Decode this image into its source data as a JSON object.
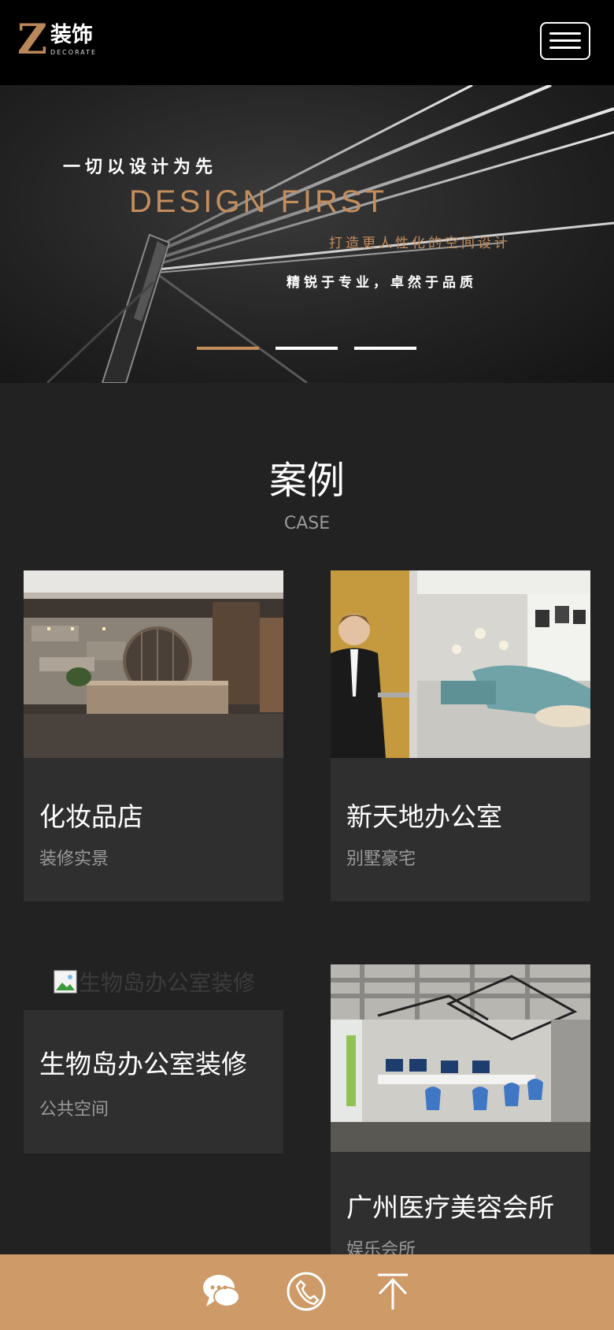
{
  "header": {
    "logo_letter": "Z",
    "logo_cn": "装饰",
    "logo_en": "DECORATE",
    "menu_icon": "hamburger-menu-icon"
  },
  "banner": {
    "line1": "一切以设计为先",
    "line2": "DESIGN FIRST",
    "line3": "打造更人性化的空间设计",
    "line4": "精锐于专业，卓然于品质",
    "slides": 3,
    "active_slide": 1
  },
  "section": {
    "title": "案例",
    "subtitle": "CASE"
  },
  "cases": [
    {
      "title": "化妆品店",
      "tag": "装修实景"
    },
    {
      "title": "新天地办公室",
      "tag": "别墅豪宅"
    },
    {
      "title": "生物岛办公室装修",
      "tag": "公共空间",
      "image_alt": "生物岛办公室装修"
    },
    {
      "title": "广州医疗美容会所",
      "tag": "娱乐会所"
    }
  ],
  "bottom_bar": {
    "icons": [
      "chat-icon",
      "phone-icon",
      "back-to-top-icon"
    ]
  },
  "colors": {
    "accent": "#c48d5c",
    "bottom_bar": "#cd9a68",
    "page_bg": "#222222",
    "card_bg": "#2f2f2f"
  }
}
